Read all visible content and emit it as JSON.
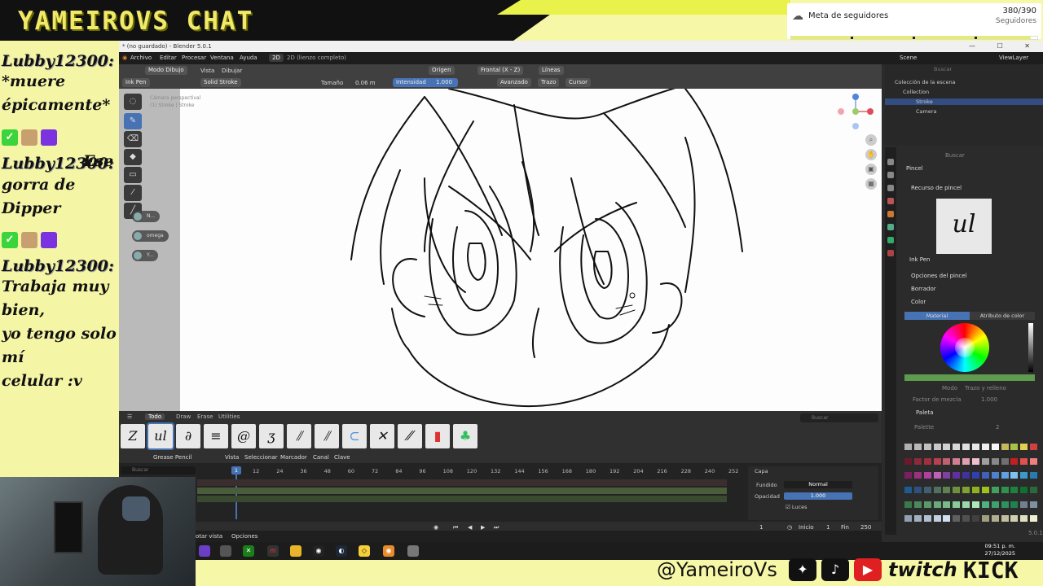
{
  "overlay": {
    "chat_title": "YAMEIROVS CHAT",
    "follower_goal": {
      "label": "Meta de seguidores",
      "count": "380/390",
      "unit": "Seguidores",
      "progress_fraction": 0.974
    },
    "chat_messages": [
      {
        "user": "Lubby12300:",
        "text": [
          "*muere",
          "épicamente*"
        ]
      },
      {
        "user": "Lubby12300:",
        "text": [
          "Ese",
          "gorra de Dipper"
        ]
      },
      {
        "user": "Lubby12300:",
        "text": [
          "Trabaja muy bien,",
          "yo tengo solo mí",
          "celular :v"
        ]
      }
    ],
    "social_handle": "@YameiroVs",
    "twitch_label": "twitch",
    "kick_label": "KICK",
    "icons": [
      "cloud-icon",
      "twitter-icon",
      "tiktok-icon",
      "youtube-icon"
    ]
  },
  "blender": {
    "window_title": "* (no guardado) - Blender 5.0.1",
    "menu": [
      "Archivo",
      "Editar",
      "Procesar",
      "Ventana",
      "Ayuda"
    ],
    "workspace_active": "2D",
    "workspace_other": "2D (lienzo completo)",
    "viewport_header": {
      "origin": "Origen",
      "view": "Frontal (X - Z)",
      "lines": "Líneas",
      "brush": "Ink Pen",
      "mode": "Modo Dibujo",
      "view_menu": "Vista",
      "draw_menu": "Dibujar",
      "stroke_type": "Solid Stroke",
      "size_label": "Tamaño",
      "size_value": "0.06 m",
      "strength_label": "Intensidad",
      "strength_value": "1.000",
      "advanced": "Avanzado",
      "stroke": "Trazo",
      "cursor": "Cursor"
    },
    "camera_text": [
      "Cámara perspectival",
      "(1) Stroke | Stroke"
    ],
    "overlay_chips": [
      "N...",
      "omega",
      "Y..."
    ],
    "brush_shelf": {
      "tabs": [
        "Todo",
        "Draw",
        "Erase",
        "Utilities"
      ],
      "active_tab": "Todo",
      "search_placeholder": "Buscar"
    },
    "timeline": {
      "editor": "Grease Pencil",
      "menus": [
        "Vista",
        "Seleccionar",
        "Marcador",
        "Canal",
        "Clave"
      ],
      "search_placeholder": "Buscar",
      "current_frame": "1",
      "frame_numbers": [
        "12",
        "24",
        "36",
        "48",
        "60",
        "72",
        "84",
        "96",
        "108",
        "120",
        "132",
        "144",
        "156",
        "168",
        "180",
        "192",
        "204",
        "216",
        "228",
        "240",
        "252"
      ],
      "start_label": "Inicio",
      "start_value": "1",
      "end_label": "Fin",
      "end_value": "250",
      "frame_field": "1",
      "layer_panel": {
        "title": "Capa",
        "blend_label": "Fundido",
        "blend_value": "Normal",
        "opacity_label": "Opacidad",
        "opacity_value": "1.000",
        "lights_label": "Luces"
      }
    },
    "status_bar": {
      "left": "otar vista",
      "options": "Opciones"
    },
    "outliner": {
      "scene": "Scene",
      "view_layer": "ViewLayer",
      "search_placeholder": "Buscar",
      "rows": [
        "Colección de la escena",
        "Collection",
        "Stroke",
        "Camera"
      ]
    },
    "properties": {
      "search_placeholder": "Buscar",
      "brush_title": "Pincel",
      "brush_resource": "Recurso de pincel",
      "brush_name": "Ink Pen",
      "brush_options": "Opciones del pincel",
      "eraser": "Borrador",
      "color": "Color",
      "material_tab": "Material",
      "color_attr_tab": "Atributo de color",
      "mode_label": "Modo",
      "mode_value": "Trazo y relleno",
      "mix_label": "Factor de mezcla",
      "mix_value": "1.000",
      "palette_title": "Paleta",
      "palette_name": "Palette",
      "palette_users": "2",
      "version": "5.0.1"
    },
    "accent_color": "#4772b3"
  },
  "taskbar": {
    "time": "09:51 p. m.",
    "date": "27/12/2025"
  }
}
